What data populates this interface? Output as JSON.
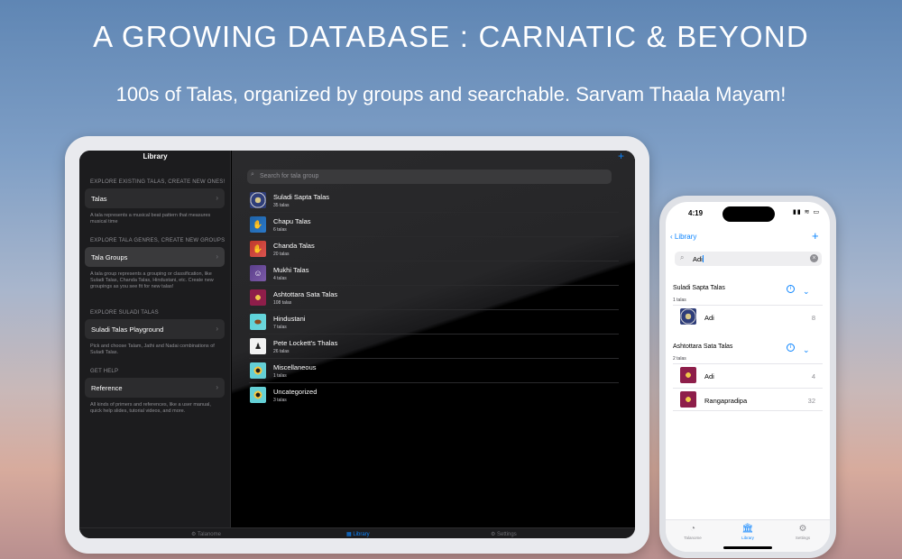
{
  "headline": "A GROWING DATABASE : CARNATIC & BEYOND",
  "subhead": "100s of Talas, organized by groups and searchable. Sarvam Thaala Mayam!",
  "ipad": {
    "sidebar": {
      "title": "Library",
      "sections": [
        {
          "header": "EXPLORE EXISTING TALAS, CREATE NEW ONES!",
          "cell": "Talas",
          "note": "A tala represents a musical beat pattern that measures musical time"
        },
        {
          "header": "EXPLORE TALA GENRES, CREATE NEW GROUPS",
          "cell": "Tala Groups",
          "note": "A tala group represents a grouping or classification, like Suladi Talas, Chanda Talas, Hindustani, etc. Create new groupings as you see fit for new talas!"
        },
        {
          "header": "EXPLORE SULADI TALAS",
          "cell": "Suladi Talas Playground",
          "note": "Pick and choose Talam, Jathi and Nadai combinations of Suladi Talas."
        },
        {
          "header": "GET HELP",
          "cell": "Reference",
          "note": "All kinds of primers and references, like a user manual, quick help slides, tutorial videos, and more."
        }
      ]
    },
    "main": {
      "plus": "+",
      "search_placeholder": "Search for tala group",
      "groups": [
        {
          "name": "Suladi Sapta Talas",
          "count": "35 talas",
          "icon": "seal-icon"
        },
        {
          "name": "Chapu Talas",
          "count": "6 talas",
          "icon": "dancer-icon"
        },
        {
          "name": "Chanda Talas",
          "count": "20 talas",
          "icon": "dancer-red-icon"
        },
        {
          "name": "Mukhi Talas",
          "count": "4 talas",
          "icon": "figure-icon"
        },
        {
          "name": "Ashtottara Sata Talas",
          "count": "108 talas",
          "icon": "emblem-icon"
        },
        {
          "name": "Hindustani",
          "count": "7 talas",
          "icon": "tabla-icon"
        },
        {
          "name": "Pete Lockett's Thalas",
          "count": "26 talas",
          "icon": "drummer-icon"
        },
        {
          "name": "Miscellaneous",
          "count": "1 talas",
          "icon": "misc-icon"
        },
        {
          "name": "Uncategorized",
          "count": "3 talas",
          "icon": "uncat-icon"
        }
      ]
    },
    "tabs": [
      "Talanome",
      "Library",
      "Settings"
    ]
  },
  "iphone": {
    "time": "4:19",
    "status": "▮▮ ≋ ▭",
    "back_label": "Library",
    "plus": "+",
    "search_value": "Adi",
    "sections": [
      {
        "title": "Suladi Sapta Talas",
        "count": "1 talas",
        "rows": [
          {
            "name": "Adi",
            "count": "8",
            "icon": "seal-icon"
          }
        ]
      },
      {
        "title": "Ashtottara Sata Talas",
        "count": "2 talas",
        "rows": [
          {
            "name": "Adi",
            "count": "4",
            "icon": "emblem-icon"
          },
          {
            "name": "Rangapradipa",
            "count": "32",
            "icon": "emblem-icon"
          }
        ]
      }
    ],
    "tabs": [
      "Talanome",
      "Library",
      "Settings"
    ]
  }
}
